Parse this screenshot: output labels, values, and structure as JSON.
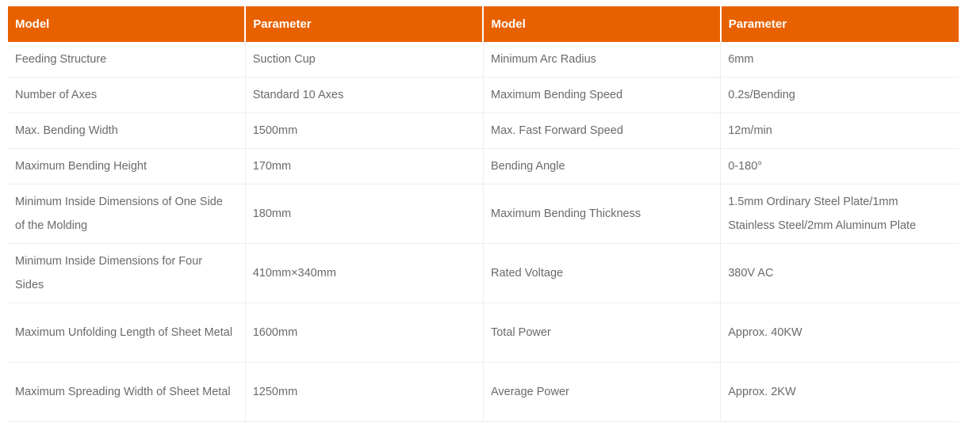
{
  "theme": {
    "header_background": "#e86100",
    "header_text_color": "#ffffff",
    "body_text_color": "#6a6a6a",
    "border_color": "#ededed",
    "page_background": "#ffffff"
  },
  "table": {
    "headers": [
      "Model",
      "Parameter",
      "Model",
      "Parameter"
    ],
    "rows": [
      {
        "height": "single",
        "cells": [
          "Feeding Structure",
          "Suction Cup",
          "Minimum Arc Radius",
          "6mm"
        ]
      },
      {
        "height": "single",
        "cells": [
          "Number of Axes",
          "Standard 10 Axes",
          "Maximum Bending Speed",
          "0.2s/Bending"
        ]
      },
      {
        "height": "single",
        "cells": [
          "Max. Bending Width",
          "1500mm",
          "Max. Fast Forward Speed",
          "12m/min"
        ]
      },
      {
        "height": "single",
        "cells": [
          "Maximum Bending Height",
          "170mm",
          "Bending Angle",
          "0-180°"
        ]
      },
      {
        "height": "double",
        "cells": [
          "Minimum Inside Dimensions of One Side of the Molding",
          "180mm",
          "Maximum Bending Thickness",
          "1.5mm Ordinary Steel Plate/1mm Stainless Steel/2mm Aluminum Plate"
        ]
      },
      {
        "height": "double",
        "cells": [
          "Minimum Inside Dimensions for Four Sides",
          "410mm×340mm",
          "Rated Voltage",
          "380V AC"
        ]
      },
      {
        "height": "double",
        "cells": [
          "Maximum Unfolding Length of Sheet Metal",
          "1600mm",
          "Total Power",
          "Approx. 40KW"
        ]
      },
      {
        "height": "double",
        "cells": [
          "Maximum Spreading Width of Sheet Metal",
          "1250mm",
          "Average Power",
          "Approx. 2KW"
        ]
      }
    ]
  }
}
